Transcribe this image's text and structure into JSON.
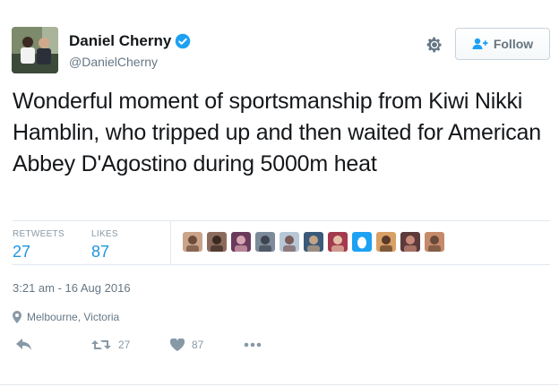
{
  "author": {
    "name": "Daniel Cherny",
    "handle": "@DanielCherny",
    "verified_icon": "verified-badge-icon"
  },
  "header": {
    "follow_label": "Follow",
    "settings_icon": "gear-icon"
  },
  "tweet": {
    "text": "Wonderful moment of sportsmanship from Kiwi Nikki Hamblin, who tripped up and then waited for American Abbey D'Agostino during 5000m heat"
  },
  "stats": {
    "retweets_label": "RETWEETS",
    "retweets_count": "27",
    "likes_label": "LIKES",
    "likes_count": "87",
    "likers": [
      {
        "color": "#c9a48a",
        "accent": "#6d4c3a"
      },
      {
        "color": "#8b6c5c",
        "accent": "#3b2a22"
      },
      {
        "color": "#6b3b5c",
        "accent": "#d8a6b3"
      },
      {
        "color": "#7c8a99",
        "accent": "#3d4450"
      },
      {
        "color": "#b8c7d6",
        "accent": "#7a5a5a"
      },
      {
        "color": "#3a5a7a",
        "accent": "#c4a484"
      },
      {
        "color": "#a33a4e",
        "accent": "#e5c0a8"
      },
      {
        "color": "#1da1f2",
        "accent": "#ffffff"
      },
      {
        "color": "#d9a066",
        "accent": "#5a3a2a"
      },
      {
        "color": "#5c3a3a",
        "accent": "#c98a7a"
      },
      {
        "color": "#c48a6a",
        "accent": "#6a4a3a"
      }
    ]
  },
  "meta": {
    "timestamp": "3:21 am - 16 Aug 2016",
    "location": "Melbourne, Victoria"
  },
  "actions": {
    "retweet_count": "27",
    "like_count": "87"
  },
  "colors": {
    "accent": "#1b95e0",
    "muted": "#8899a6",
    "border": "#e1e8ed"
  }
}
